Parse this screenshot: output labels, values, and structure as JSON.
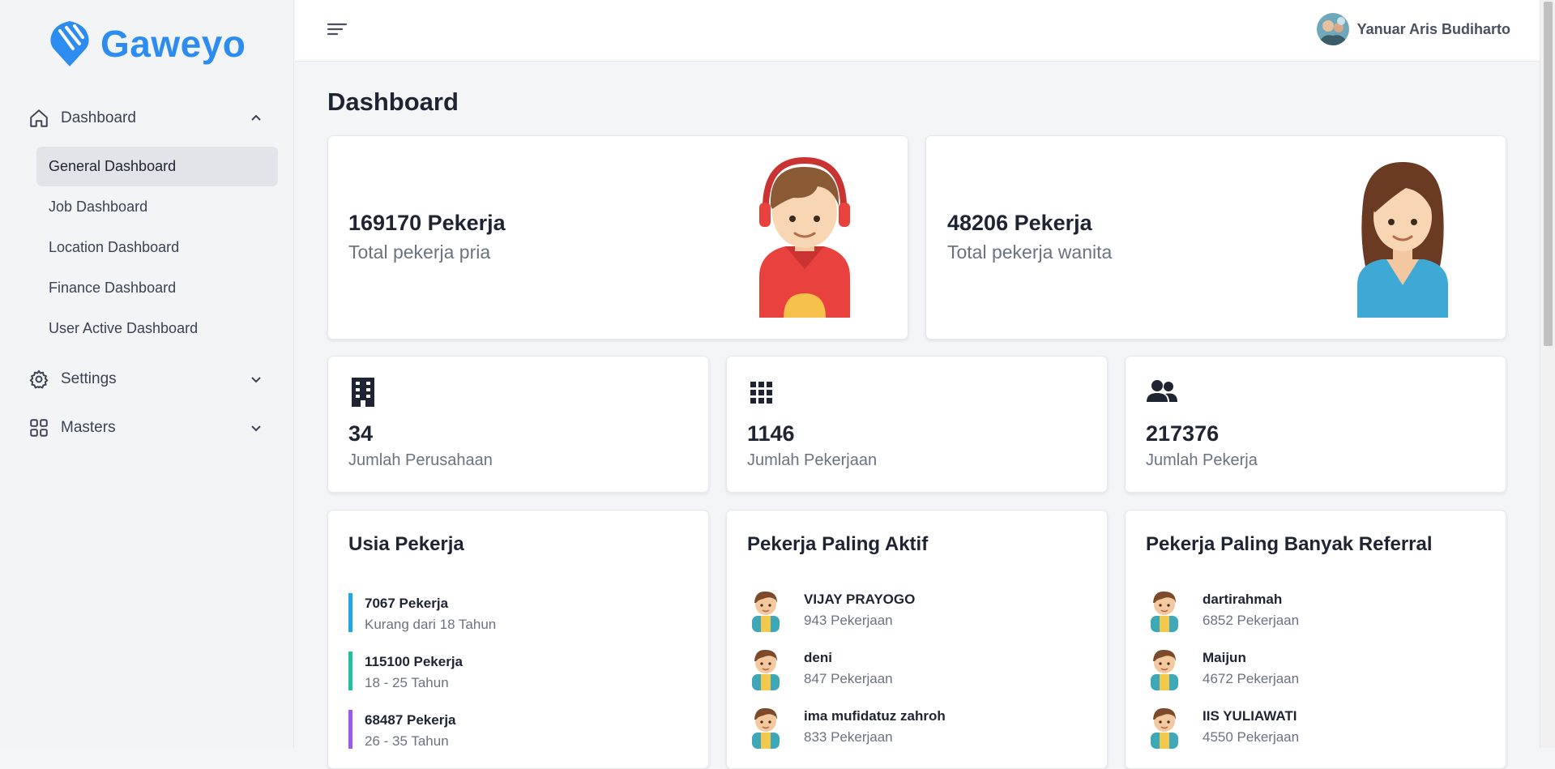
{
  "app": {
    "name": "Gaweyo",
    "brand_color": "#2d8cf0"
  },
  "sidebar": {
    "groups": [
      {
        "label": "Dashboard",
        "icon": "home-icon",
        "expanded": true
      },
      {
        "label": "Settings",
        "icon": "gear-icon",
        "expanded": false
      },
      {
        "label": "Masters",
        "icon": "grid-icon",
        "expanded": false
      }
    ],
    "dashboard_items": [
      {
        "label": "General Dashboard",
        "active": true
      },
      {
        "label": "Job Dashboard"
      },
      {
        "label": "Location Dashboard"
      },
      {
        "label": "Finance Dashboard"
      },
      {
        "label": "User Active Dashboard"
      }
    ]
  },
  "header": {
    "user_name": "Yanuar Aris Budiharto"
  },
  "page": {
    "title": "Dashboard"
  },
  "gender_cards": [
    {
      "count": "169170 Pekerja",
      "label": "Total pekerja pria",
      "illustration": "male-worker-illustration"
    },
    {
      "count": "48206 Pekerja",
      "label": "Total pekerja wanita",
      "illustration": "female-worker-illustration"
    }
  ],
  "stats": [
    {
      "value": "34",
      "label": "Jumlah Perusahaan",
      "icon": "building-icon"
    },
    {
      "value": "1146",
      "label": "Jumlah Pekerjaan",
      "icon": "grid-dots-icon"
    },
    {
      "value": "217376",
      "label": "Jumlah Pekerja",
      "icon": "users-icon"
    }
  ],
  "age_panel": {
    "title": "Usia Pekerja",
    "items": [
      {
        "count": "7067 Pekerja",
        "range": "Kurang dari 18 Tahun",
        "color": "#1ea7e4"
      },
      {
        "count": "115100 Pekerja",
        "range": "18 - 25 Tahun",
        "color": "#20c0a0"
      },
      {
        "count": "68487 Pekerja",
        "range": "26 - 35 Tahun",
        "color": "#9b59f0"
      }
    ]
  },
  "active_panel": {
    "title": "Pekerja Paling Aktif",
    "items": [
      {
        "name": "VIJAY PRAYOGO",
        "count": "943 Pekerjaan"
      },
      {
        "name": "deni",
        "count": "847 Pekerjaan"
      },
      {
        "name": "ima mufidatuz zahroh",
        "count": "833 Pekerjaan"
      }
    ]
  },
  "referral_panel": {
    "title": "Pekerja Paling Banyak Referral",
    "items": [
      {
        "name": "dartirahmah",
        "count": "6852 Pekerjaan"
      },
      {
        "name": "Maijun",
        "count": "4672 Pekerjaan"
      },
      {
        "name": "IIS YULIAWATI",
        "count": "4550 Pekerjaan"
      }
    ]
  }
}
